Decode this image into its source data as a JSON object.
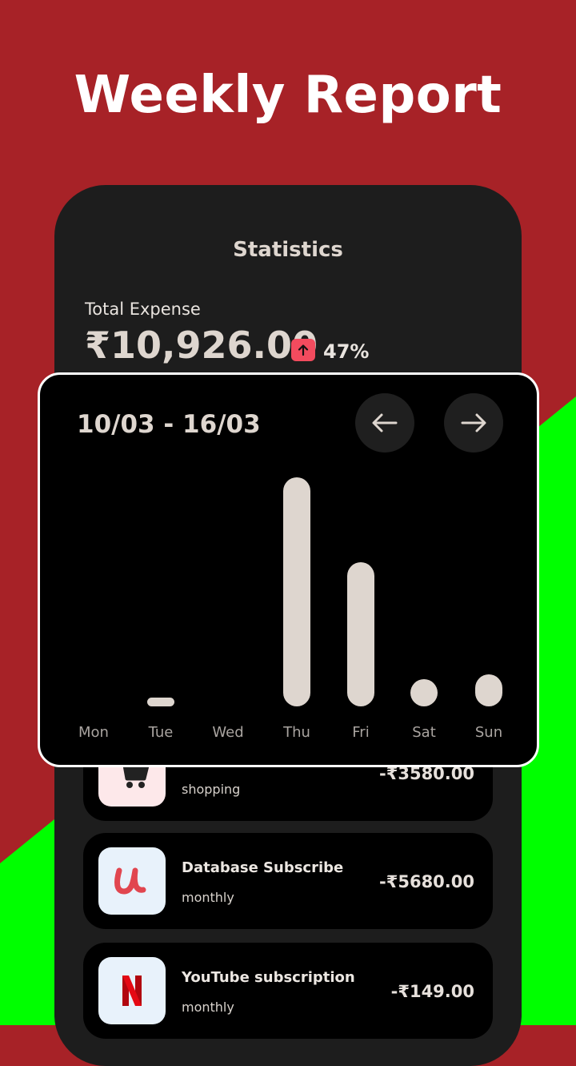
{
  "headline": "Weekly Report",
  "screen": {
    "title": "Statistics",
    "total_label": "Total Expense",
    "total_amount": "₹10,926.00",
    "trend_percent": "47%",
    "trend_icon": "arrow-up-icon"
  },
  "colors": {
    "top_bg": "#a72227",
    "bottom_bg": "#00ff00",
    "phone_bg": "#1d1d1d",
    "bar": "#ded6cf",
    "trend_badge": "#f24b5e"
  },
  "chart": {
    "range": "10/03 - 16/03",
    "prev_icon": "arrow-left-icon",
    "next_icon": "arrow-right-icon"
  },
  "chart_data": {
    "type": "bar",
    "categories": [
      "Mon",
      "Tue",
      "Wed",
      "Thu",
      "Fri",
      "Sat",
      "Sun"
    ],
    "values": [
      0,
      0.04,
      0,
      1.0,
      0.63,
      0.12,
      0.14
    ],
    "title": "",
    "xlabel": "",
    "ylabel": ""
  },
  "transactions": [
    {
      "name": "",
      "category": "shopping",
      "amount": "-₹3580.00",
      "icon": "shopping-cart-icon"
    },
    {
      "name": "Database Subscribe",
      "category": "monthly",
      "amount": "-₹5680.00",
      "icon": "udemy-logo-icon"
    },
    {
      "name": "YouTube subscription",
      "category": "monthly",
      "amount": "-₹149.00",
      "icon": "netflix-logo-icon"
    }
  ]
}
